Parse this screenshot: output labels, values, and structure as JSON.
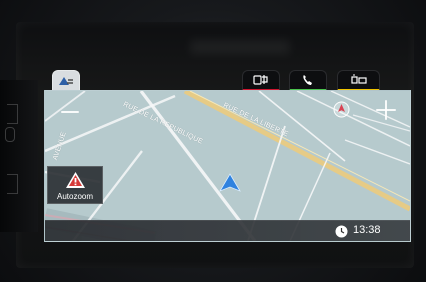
{
  "streets": {
    "street_1": "RUE DE LA REPUBLIQUE",
    "street_2": "RUE DE LA LIBERTE",
    "street_3": "AVENUE"
  },
  "controls": {
    "autozoom_label": "Autozoom"
  },
  "status": {
    "time": "13:38"
  },
  "icons": {
    "nav_tab": "map-tab-icon",
    "media_tab": "media-tab-icon",
    "phone_tab": "phone-tab-icon",
    "car_tab": "car-tab-icon",
    "zoom_out": "minus-icon",
    "zoom_in": "plus-icon",
    "compass": "compass-icon",
    "autozoom": "warning-triangle-icon",
    "position": "navigation-arrow-icon",
    "clock": "clock-icon"
  },
  "colors": {
    "map_background": "#b6cacd",
    "major_road": "#e6cb86",
    "minor_road": "#ffffff",
    "position_marker": "#2f82df",
    "media_accent": "#cf1630",
    "phone_accent": "#4bc34e",
    "car_accent": "#f0c400"
  }
}
